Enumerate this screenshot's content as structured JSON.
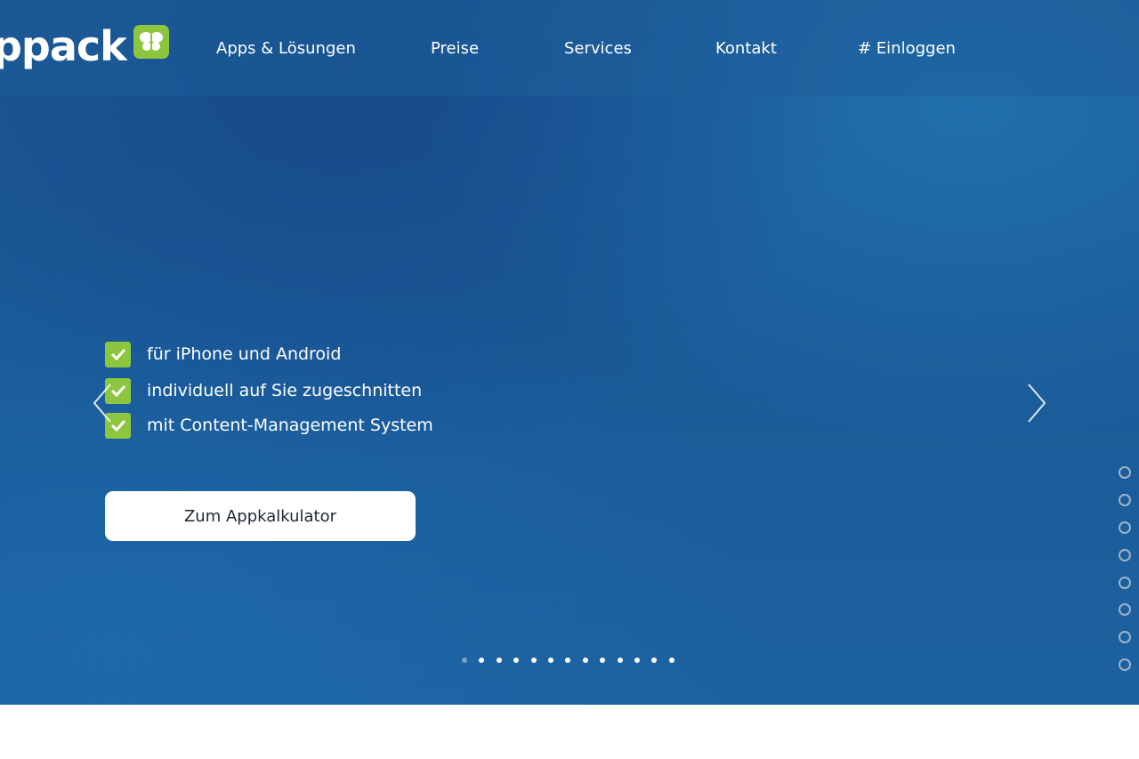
{
  "header": {
    "logo_text": "ppack",
    "nav": [
      {
        "label": "Apps & Lösungen"
      },
      {
        "label": "Preise"
      },
      {
        "label": "Services"
      },
      {
        "label": "Kontakt"
      },
      {
        "label": "# Einloggen"
      }
    ]
  },
  "hero": {
    "features": [
      {
        "text": "für iPhone und Android"
      },
      {
        "text": "individuell auf Sie zugeschnitten"
      },
      {
        "text": "mit Content-Management System"
      }
    ],
    "cta_label": "Zum Appkalkulator",
    "slide_count": 13,
    "active_slide": 1,
    "section_count": 8
  },
  "colors": {
    "accent_green": "#8cc63f",
    "hero_blue": "#1b5a97",
    "button_bg": "#ffffff",
    "button_text": "#1c2836"
  },
  "icons": {
    "logo_mark": "butterfly-icon",
    "feature_bullet": "check-icon",
    "prev": "chevron-left-icon",
    "next": "chevron-right-icon"
  }
}
